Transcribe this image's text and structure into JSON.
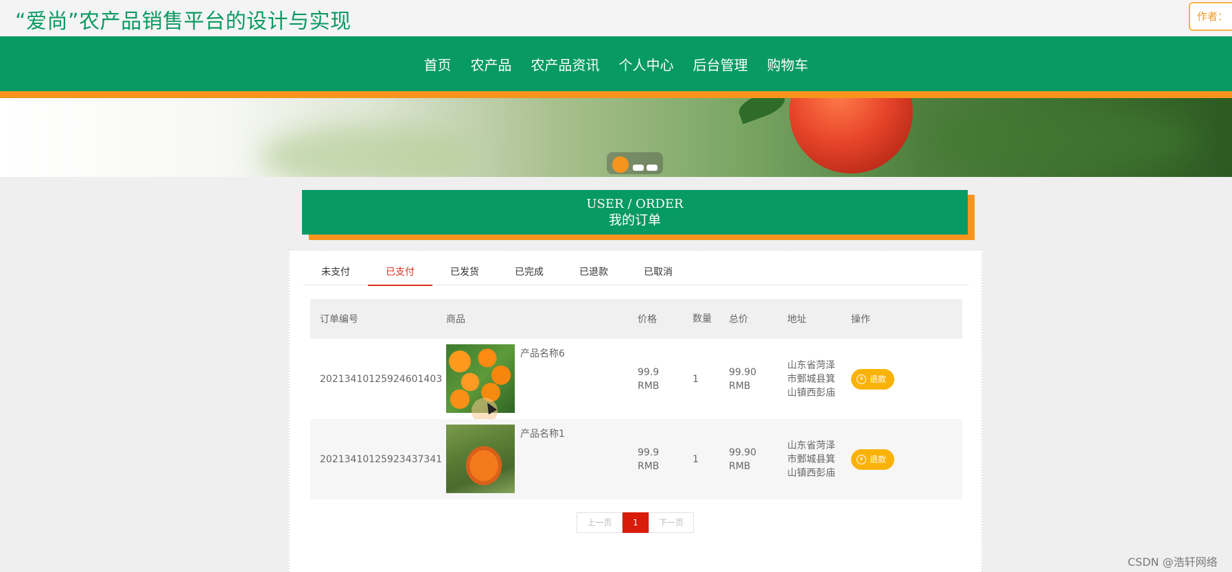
{
  "site": {
    "title": "“爱尚”农产品销售平台的设计与实现",
    "author_label": "作者："
  },
  "nav": {
    "items": [
      "首页",
      "农产品",
      "农产品资讯",
      "个人中心",
      "后台管理",
      "购物车"
    ]
  },
  "section": {
    "title_en": "USER / ORDER",
    "title_cn": "我的订单"
  },
  "tabs": {
    "items": [
      "未支付",
      "已支付",
      "已发货",
      "已完成",
      "已退款",
      "已取消"
    ],
    "active": "已支付"
  },
  "table": {
    "headers": {
      "id": "订单编号",
      "goods": "商品",
      "price": "价格",
      "qty": "数量",
      "total": "总价",
      "addr": "地址",
      "op": "操作"
    },
    "rows": [
      {
        "id": "20213410125924601403",
        "name": "产品名称6",
        "price": "99.9 RMB",
        "qty": "1",
        "total": "99.90 RMB",
        "addr": "山东省菏泽市鄄城县箕山镇西彭庙",
        "action": "退款",
        "image_icon": "tangerine-image"
      },
      {
        "id": "20213410125923437341",
        "name": "产品名称1",
        "price": "99.9 RMB",
        "qty": "1",
        "total": "99.90 RMB",
        "addr": "山东省菏泽市鄄城县箕山镇西彭庙",
        "action": "退款",
        "image_icon": "pumpkin-image"
      }
    ]
  },
  "pager": {
    "prev": "上一页",
    "current": "1",
    "next": "下一页"
  },
  "watermark": "CSDN @浩轩网络",
  "colors": {
    "brand_green": "#079a63",
    "accent_orange": "#f7941d",
    "active_red": "#d9301f",
    "refund_yellow": "#f9b208"
  }
}
